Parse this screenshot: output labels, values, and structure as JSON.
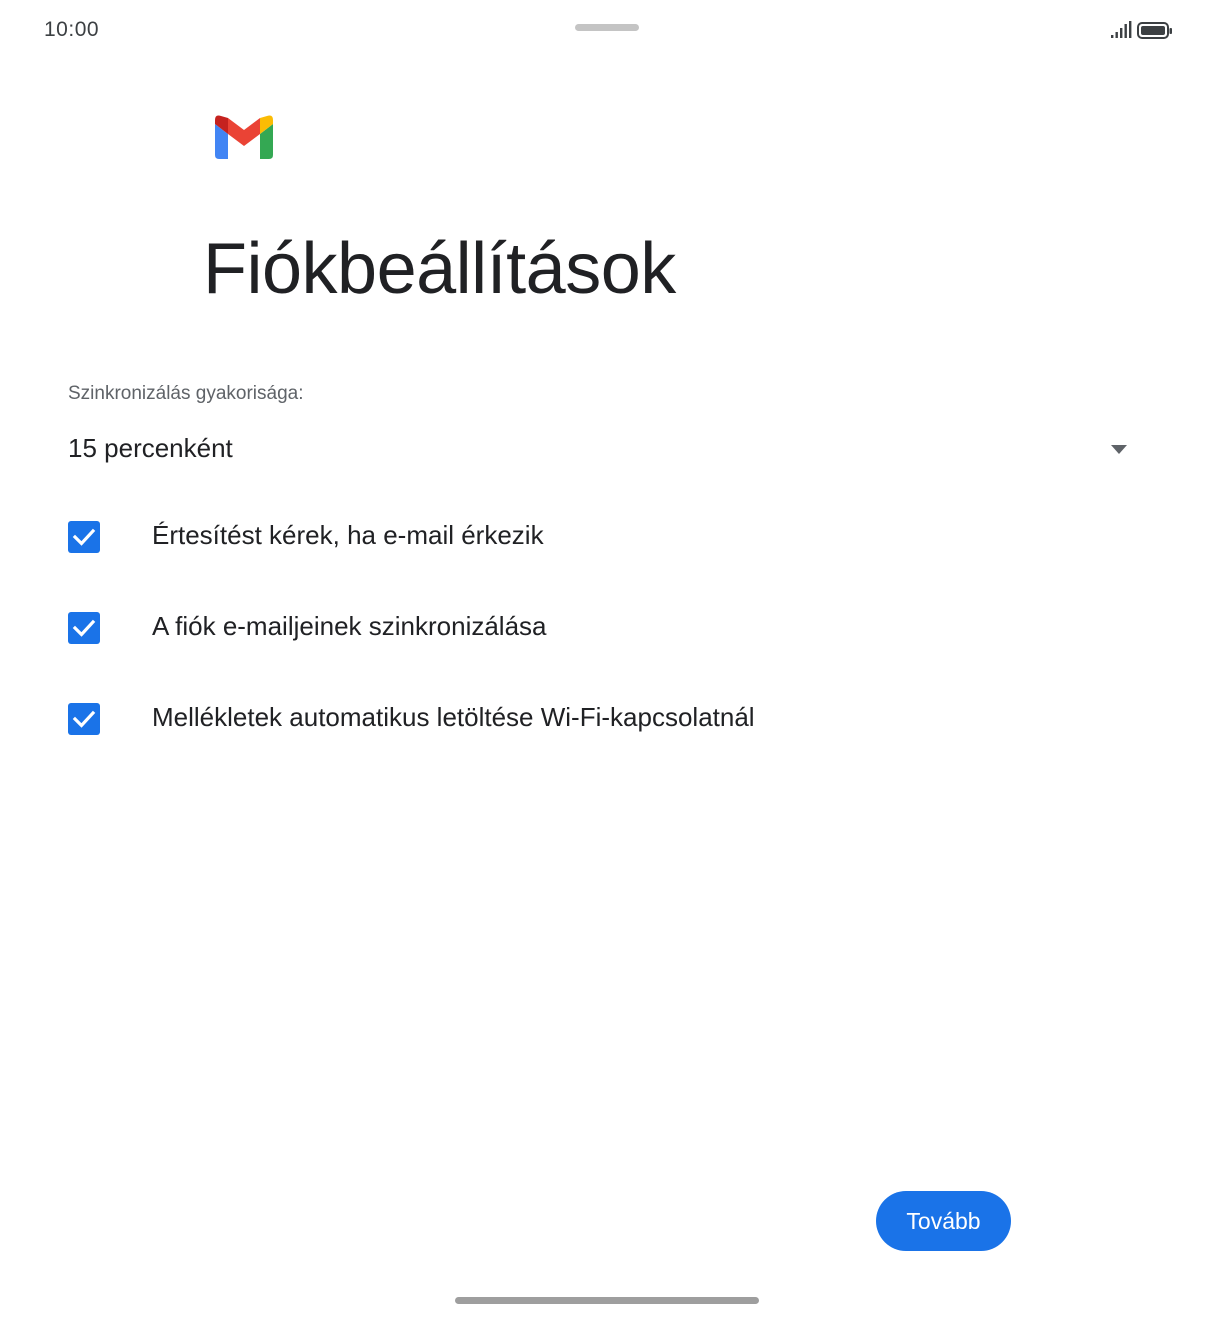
{
  "status_bar": {
    "time": "10:00",
    "icons": [
      "signal-icon",
      "battery-icon"
    ]
  },
  "logo": "gmail-logo",
  "title": "Fiókbeállítások",
  "sync": {
    "label": "Szinkronizálás gyakorisága:",
    "value": "15 percenként",
    "icon": "dropdown-arrow-icon"
  },
  "options": [
    {
      "label": "Értesítést kérek, ha e-mail érkezik",
      "checked": true
    },
    {
      "label": "A fiók e-mailjeinek szinkronizálása",
      "checked": true
    },
    {
      "label": "Mellékletek automatikus letöltése Wi-Fi-kapcsolatnál",
      "checked": true
    }
  ],
  "next_button": {
    "label": "Tovább"
  },
  "colors": {
    "accent": "#1a73e8",
    "text": "#202124",
    "secondary_text": "#5f6368",
    "gmail_red": "#ea4335",
    "gmail_blue": "#4285f4",
    "gmail_green": "#34a853",
    "gmail_yellow": "#fbbc04",
    "gmail_dark_red": "#c5221f"
  }
}
